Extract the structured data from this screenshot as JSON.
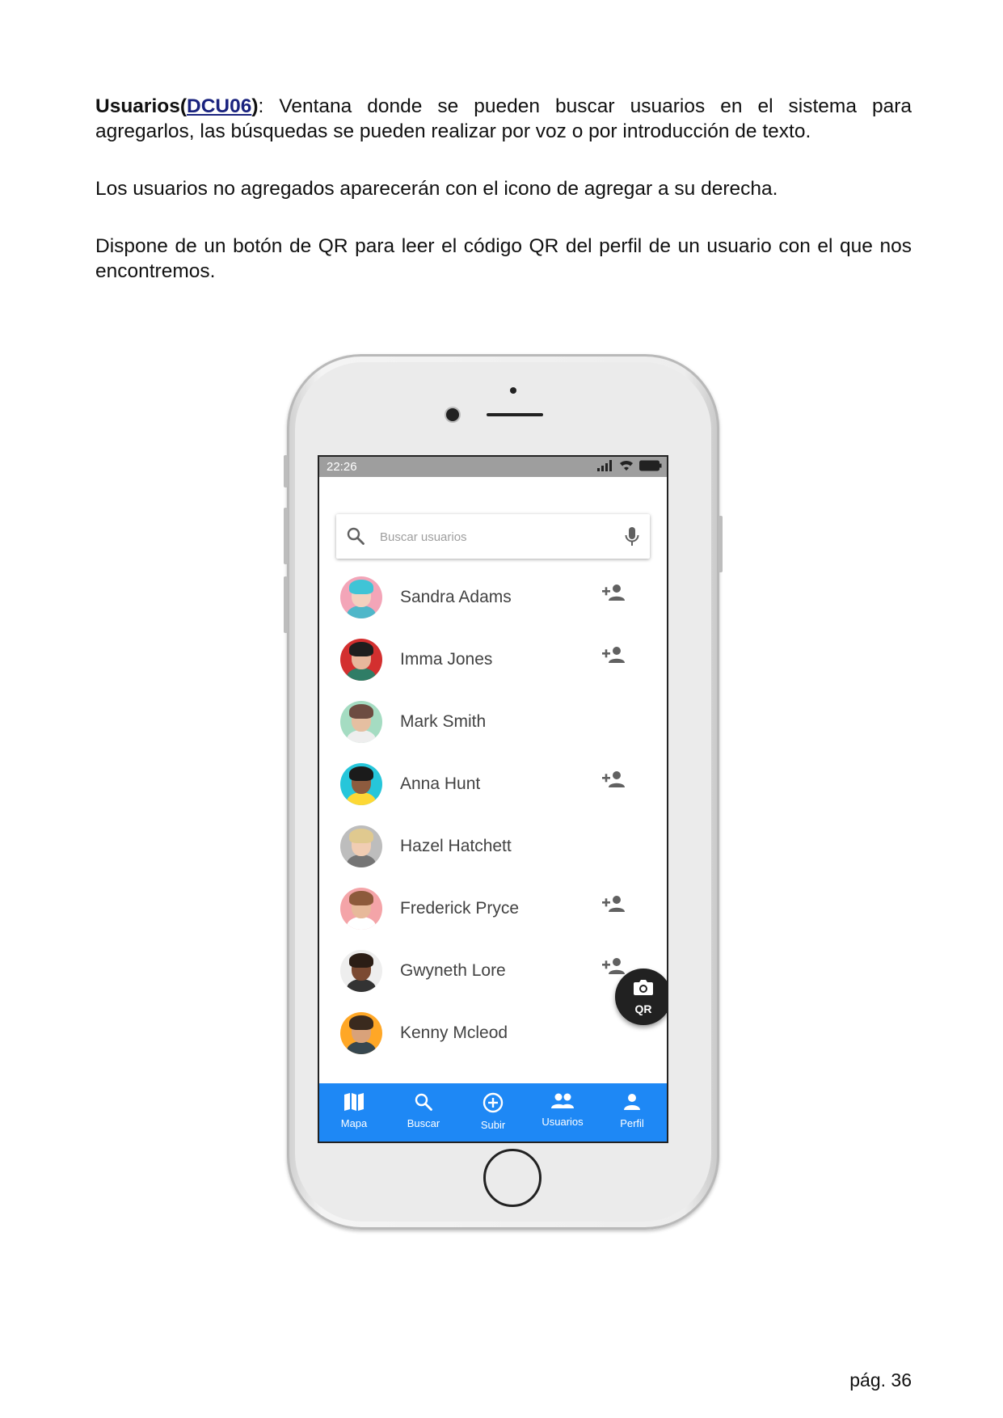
{
  "document": {
    "para1_bold": "Usuarios(",
    "para1_link": "DCU06",
    "para1_bold_close": ")",
    "para1_text": ": Ventana donde se pueden buscar usuarios en el sistema para agregarlos, las búsquedas se pueden realizar por voz o por introducción de texto.",
    "para2": "Los usuarios no agregados aparecerán con el icono de agregar a su derecha.",
    "para3": "Dispone de un botón de QR para leer el código QR del perfil de un usuario con el que nos encontremos.",
    "page_number": "pág. 36"
  },
  "phone": {
    "status_time": "22:26",
    "search": {
      "placeholder": "Buscar usuarios"
    },
    "users": [
      {
        "name": "Sandra Adams",
        "show_add": true,
        "avatar_bg": "#f3a5b8",
        "hair": "#3fc4d6",
        "skin": "#f3d1bf",
        "shirt": "#4fb7c9"
      },
      {
        "name": "Imma Jones",
        "show_add": true,
        "avatar_bg": "#d32f2f",
        "hair": "#1e1e1e",
        "skin": "#e7b79c",
        "shirt": "#2f7d66"
      },
      {
        "name": "Mark Smith",
        "show_add": false,
        "avatar_bg": "#a5dcc2",
        "hair": "#6d4c41",
        "skin": "#e5bfa1",
        "shirt": "#eeeeee"
      },
      {
        "name": "Anna Hunt",
        "show_add": true,
        "avatar_bg": "#26c6da",
        "hair": "#1b1b1b",
        "skin": "#8d5b3e",
        "shirt": "#fdd835"
      },
      {
        "name": "Hazel Hatchett",
        "show_add": false,
        "avatar_bg": "#bdbdbd",
        "hair": "#e0c98f",
        "skin": "#f1cdb3",
        "shirt": "#757575"
      },
      {
        "name": "Frederick Pryce",
        "show_add": true,
        "avatar_bg": "#f4a4a8",
        "hair": "#8d5a3b",
        "skin": "#e7b99a",
        "shirt": "#ffffff"
      },
      {
        "name": "Gwyneth Lore",
        "show_add": true,
        "avatar_bg": "#eeeeee",
        "hair": "#2b1d15",
        "skin": "#7b4a32",
        "shirt": "#333333"
      },
      {
        "name": "Kenny Mcleod",
        "show_add": false,
        "avatar_bg": "#ffa726",
        "hair": "#3a2a1e",
        "skin": "#d9a27a",
        "shirt": "#37474f"
      }
    ],
    "fab_label": "QR",
    "nav": [
      {
        "label": "Mapa",
        "icon": "map-icon"
      },
      {
        "label": "Buscar",
        "icon": "search-icon"
      },
      {
        "label": "Subir",
        "icon": "add-circle-icon"
      },
      {
        "label": "Usuarios",
        "icon": "people-icon"
      },
      {
        "label": "Perfil",
        "icon": "person-icon"
      }
    ],
    "colors": {
      "nav_bg": "#1e88f5",
      "fab_bg": "#212121",
      "status_bar": "#9e9e9e"
    }
  }
}
